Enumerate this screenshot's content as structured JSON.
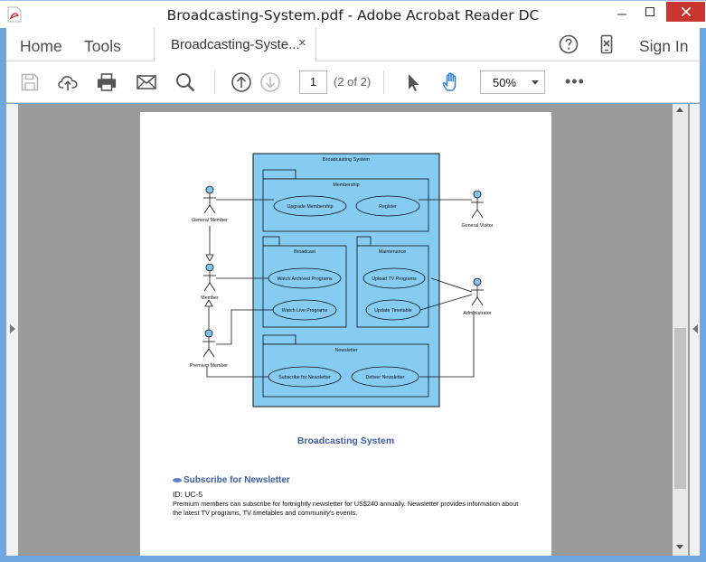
{
  "window": {
    "title": "Broadcasting-System.pdf - Adobe Acrobat Reader DC",
    "close_icon": "close-icon",
    "colors": {
      "frame": "#6ea6dd",
      "close": "#c7372f"
    }
  },
  "tabbar": {
    "home_label": "Home",
    "tools_label": "Tools",
    "document_tab_label": "Broadcasting-Syste...",
    "close_tab_glyph": "×",
    "sign_in_label": "Sign In"
  },
  "toolbar": {
    "page_value": "1",
    "page_count": "(2 of 2)",
    "zoom_value": "50%",
    "more_glyph": "•••"
  },
  "diagram": {
    "system_title": "Broadcasting System",
    "packages": [
      {
        "label": "Membership"
      },
      {
        "label": "Broadcast"
      },
      {
        "label": "Maintenance"
      },
      {
        "label": "Newsletter"
      }
    ],
    "use_cases": [
      "Upgrade Membership",
      "Register",
      "Watch Archived Programs",
      "Watch Live Programs",
      "Upload TV Programs",
      "Update Timetable",
      "Subscribe for Newsletter",
      "Deliver Newsletter"
    ],
    "actors": [
      "General Member",
      "General Visitor",
      "Member",
      "Administrator",
      "Premium Member"
    ],
    "colors": {
      "system_fill": "#86cbf1",
      "actor_head": "#7fc4ee"
    }
  },
  "document": {
    "caption": "Broadcasting System",
    "section_title": "Subscribe for Newsletter",
    "use_case_id": "ID: UC-5",
    "description": "Premium members can subscribe for fortnightly newsletter for US$240 annually. Newsletter provides information about the latest TV programs, TV timetables and community's events."
  }
}
